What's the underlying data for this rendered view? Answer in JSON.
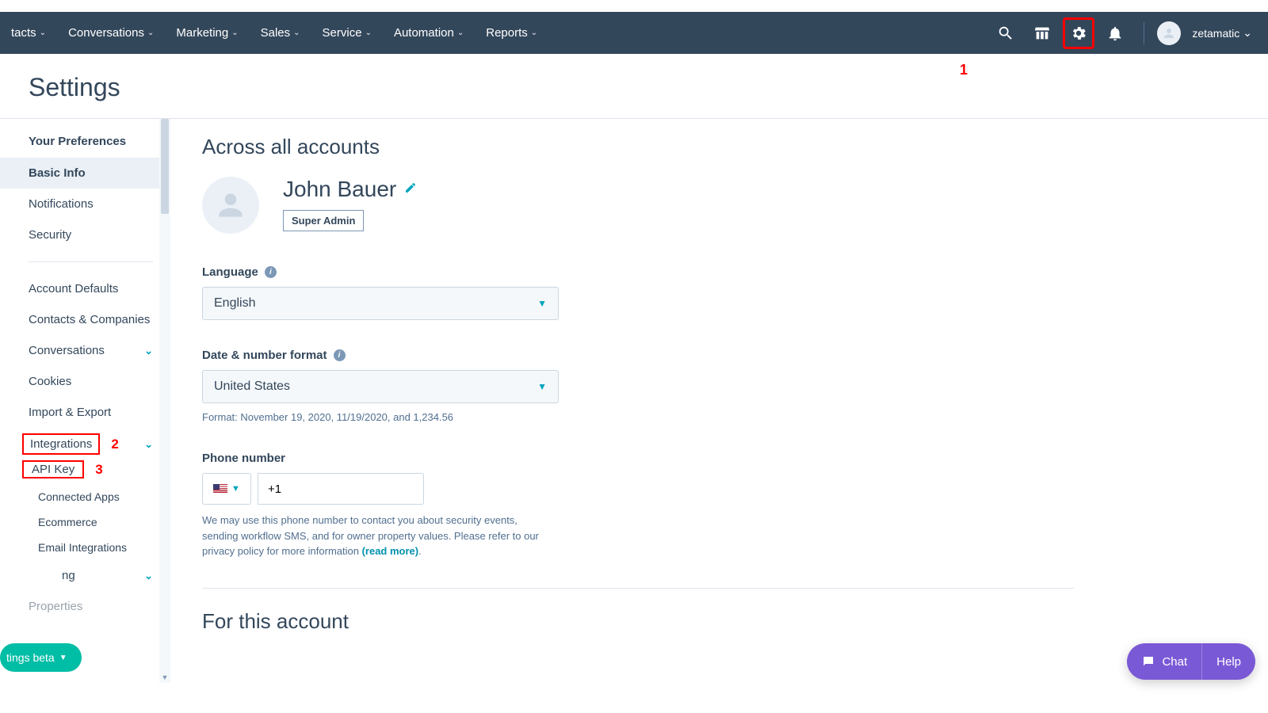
{
  "nav": {
    "items": [
      {
        "label": "tacts"
      },
      {
        "label": "Conversations"
      },
      {
        "label": "Marketing"
      },
      {
        "label": "Sales"
      },
      {
        "label": "Service"
      },
      {
        "label": "Automation"
      },
      {
        "label": "Reports"
      }
    ],
    "account_name": "zetamatic"
  },
  "annotations": {
    "gear": "1",
    "integrations": "2",
    "apikey": "3"
  },
  "page_title": "Settings",
  "sidebar": {
    "section_title": "Your Preferences",
    "items_a": [
      {
        "label": "Basic Info",
        "active": true
      },
      {
        "label": "Notifications"
      },
      {
        "label": "Security"
      }
    ],
    "items_b": [
      {
        "label": "Account Defaults"
      },
      {
        "label": "Contacts & Companies"
      },
      {
        "label": "Conversations",
        "chevron": true
      },
      {
        "label": "Cookies"
      },
      {
        "label": "Import & Export"
      }
    ],
    "integrations_label": "Integrations",
    "integration_children": [
      {
        "label": "API Key",
        "boxed": true
      },
      {
        "label": "Connected Apps"
      },
      {
        "label": "Ecommerce"
      },
      {
        "label": "Email Integrations"
      }
    ],
    "tail_item": {
      "label": "ng",
      "chevron": true
    },
    "tail_item2": {
      "label": "Properties"
    }
  },
  "main": {
    "across_title": "Across all accounts",
    "profile": {
      "name": "John Bauer",
      "role": "Super Admin"
    },
    "language": {
      "label": "Language",
      "value": "English"
    },
    "dateformat": {
      "label": "Date & number format",
      "value": "United States",
      "hint": "Format: November 19, 2020, 11/19/2020, and 1,234.56"
    },
    "phone": {
      "label": "Phone number",
      "prefix": "+1",
      "help_text": "We may use this phone number to contact you about security events, sending workflow SMS, and for owner property values. Please refer to our privacy policy for more information ",
      "link_text": "(read more)",
      "help_tail": "."
    },
    "for_account_title": "For this account"
  },
  "beta_pill": "tings beta",
  "chat": {
    "chat_label": "Chat",
    "help_label": "Help"
  }
}
